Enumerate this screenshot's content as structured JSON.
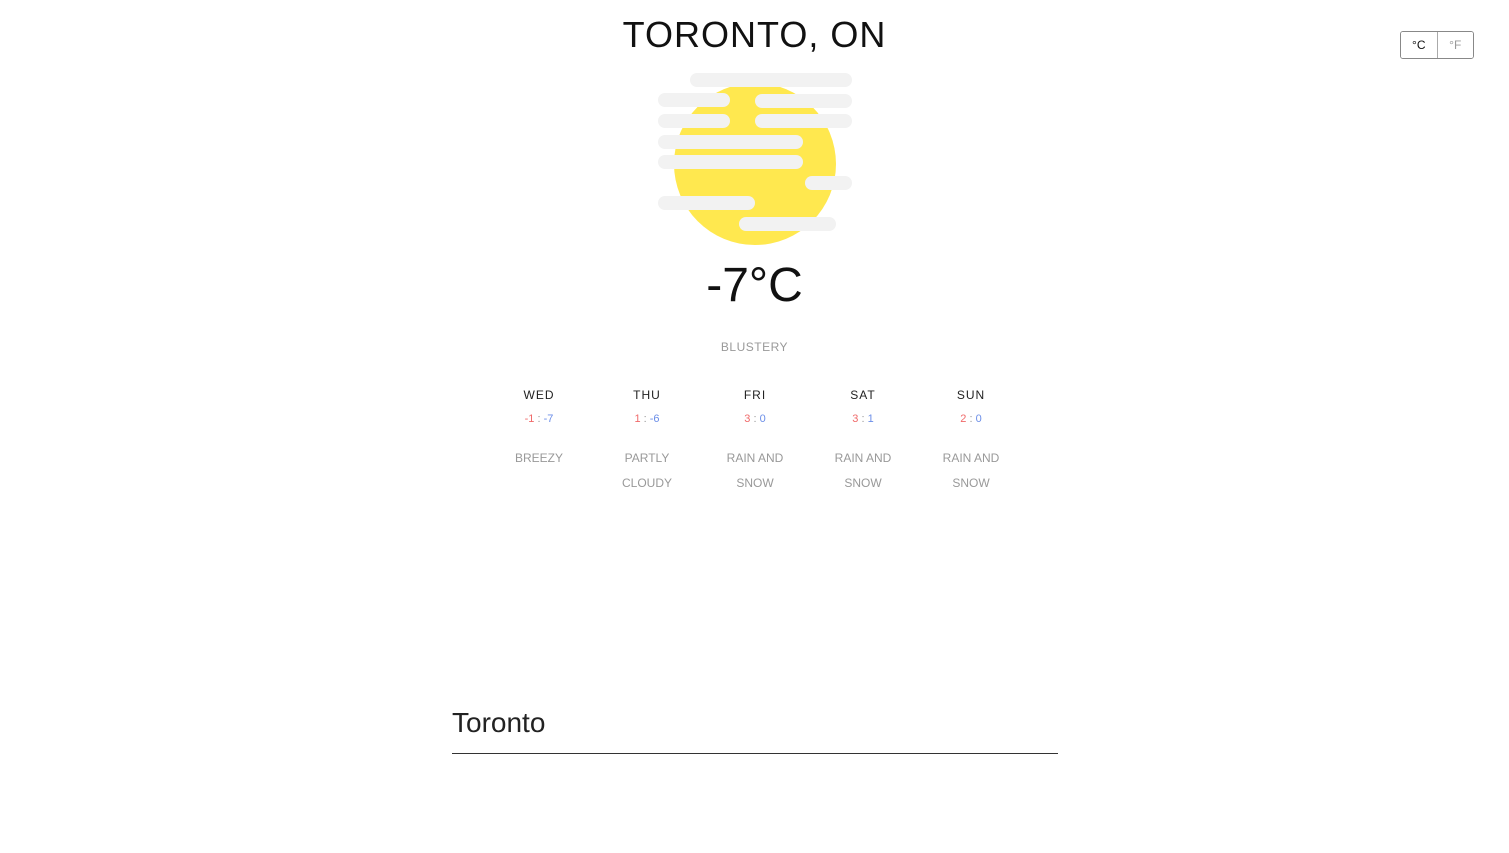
{
  "location": {
    "title": "TORONTO, ON"
  },
  "units": {
    "celsius_label": "°C",
    "fahrenheit_label": "°F",
    "active": "C"
  },
  "current": {
    "icon": "sun-behind-wind-icon",
    "temperature": "-7°C",
    "condition": "BLUSTERY"
  },
  "forecast": [
    {
      "day": "WED",
      "high": "-1",
      "sep": " : ",
      "low": "-7",
      "condition": "BREEZY"
    },
    {
      "day": "THU",
      "high": "1",
      "sep": " : ",
      "low": "-6",
      "condition": "PARTLY CLOUDY"
    },
    {
      "day": "FRI",
      "high": "3",
      "sep": " : ",
      "low": "0",
      "condition": "RAIN AND SNOW"
    },
    {
      "day": "SAT",
      "high": "3",
      "sep": " : ",
      "low": "1",
      "condition": "RAIN AND SNOW"
    },
    {
      "day": "SUN",
      "high": "2",
      "sep": " : ",
      "low": "0",
      "condition": "RAIN AND SNOW"
    }
  ],
  "search": {
    "value": "Toronto"
  },
  "colors": {
    "sun": "#ffe84f",
    "wind": "#f2f2f2",
    "high_temp": "#f06a6a",
    "low_temp": "#6b8ee8",
    "muted_text": "#999999"
  }
}
